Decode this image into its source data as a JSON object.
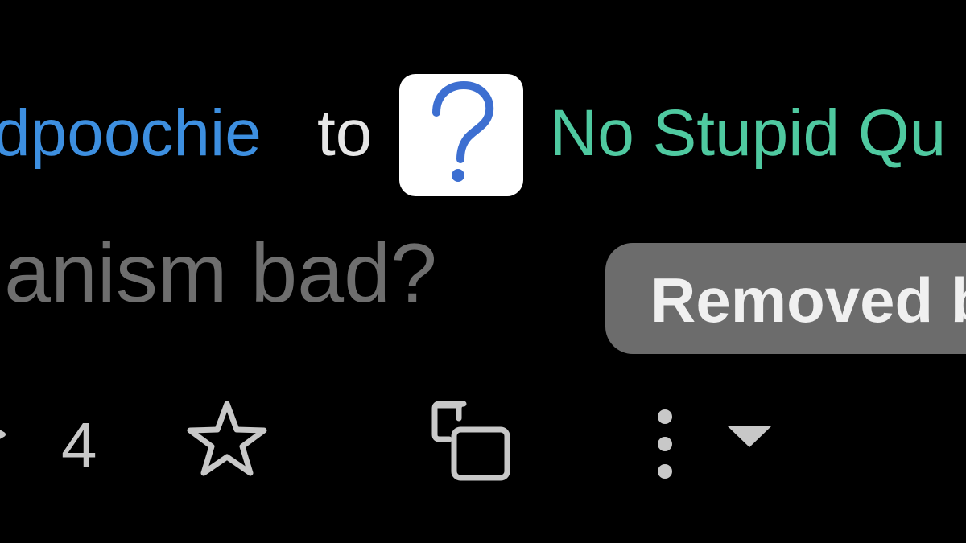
{
  "post": {
    "author": "dpoochie",
    "connector": "to",
    "community": {
      "name": "No Stupid Qu",
      "icon": "question-mark-icon",
      "icon_color": "#3d6fd1"
    },
    "title": "ianism bad?",
    "status_badge": "Removed b",
    "vote_count": "4"
  },
  "colors": {
    "background": "#000000",
    "author": "#3d8fe0",
    "community": "#4fc9a0",
    "title": "#6e6e6e",
    "badge_bg": "#6c6c6c",
    "badge_text": "#f0f0f0",
    "icons": "#c8c8c8"
  },
  "actions": {
    "icons": [
      "downvote-arrow-icon",
      "star-icon",
      "copy-icon",
      "more-vertical-icon",
      "caret-down-icon"
    ]
  }
}
